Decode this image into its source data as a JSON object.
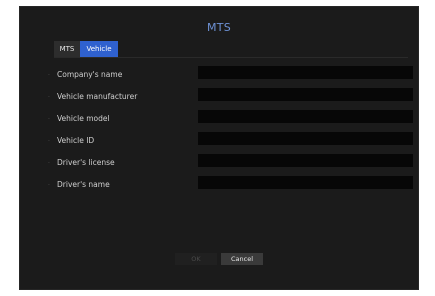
{
  "dialog": {
    "title": "MTS"
  },
  "tabs": [
    {
      "label": "MTS",
      "active": false
    },
    {
      "label": "Vehicle",
      "active": true
    }
  ],
  "fields": [
    {
      "label": "Company's name",
      "value": ""
    },
    {
      "label": "Vehicle manufacturer",
      "value": ""
    },
    {
      "label": "Vehicle model",
      "value": ""
    },
    {
      "label": "Vehicle ID",
      "value": ""
    },
    {
      "label": "Driver's license",
      "value": ""
    },
    {
      "label": "Driver's name",
      "value": ""
    }
  ],
  "buttons": {
    "ok_label": "OK",
    "ok_enabled": false,
    "cancel_label": "Cancel"
  },
  "colors": {
    "title": "#6e92d6",
    "active_tab": "#2f61cf",
    "background": "#1b1b1b",
    "input": "#070707"
  }
}
